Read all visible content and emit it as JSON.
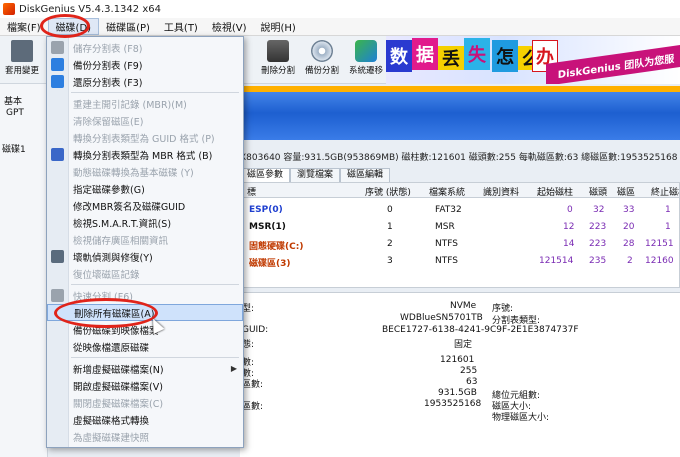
{
  "window": {
    "title": "DiskGenius V5.4.3.1342 x64"
  },
  "menubar": [
    "檔案(F)",
    "磁碟(D)",
    "磁碟區(P)",
    "工具(T)",
    "檢視(V)",
    "說明(H)"
  ],
  "toolbar": {
    "left_label": "套用變更",
    "buttons": [
      "刪除分割",
      "備份分割",
      "系統遷移"
    ]
  },
  "banner": {
    "tiles": [
      "数",
      "据",
      "丢",
      "失",
      "怎",
      "么",
      "办"
    ],
    "ribbon_text": "DiskGenius 团队为您服"
  },
  "left_panel": {
    "labels": [
      "基本",
      "GPT",
      "磁碟1 "
    ]
  },
  "disk_info": "X803640  容量:931.5GB(953869MB)  磁柱數:121601  磁頭數:255  每軌磁區數:63  總磁區數:1953525168",
  "tabs": [
    "磁區參數",
    "瀏覽檔案",
    "磁區編輯"
  ],
  "partition_table": {
    "headers": [
      "標",
      "序號 (狀態)",
      "檔案系統",
      "識別資料",
      "起始磁柱",
      "磁頭",
      "磁區",
      "終止磁柱"
    ],
    "rows": [
      {
        "name": "ESP(0)",
        "seq": "0",
        "fs": "FAT32",
        "cyl": "0",
        "head": "32",
        "sec": "33",
        "end": "1"
      },
      {
        "name": "MSR(1)",
        "seq": "1",
        "fs": "MSR",
        "cyl": "12",
        "head": "223",
        "sec": "20",
        "end": "1"
      },
      {
        "name": "固態硬碟(C:)",
        "seq": "2",
        "fs": "NTFS",
        "cyl": "14",
        "head": "223",
        "sec": "28",
        "end": "12151"
      },
      {
        "name": "磁碟區(3)",
        "seq": "3",
        "fs": "NTFS",
        "cyl": "121514",
        "head": "235",
        "sec": "2",
        "end": "12160"
      }
    ]
  },
  "details": {
    "type_label": "型:",
    "type_value": "NVMe",
    "model_value": "WDBlueSN5701TB",
    "guid_label": "GUID:",
    "guid_value": "BECE1727-6138-4241-9C9F-2E1E3874737F",
    "status_label": "態:",
    "status_value": "固定",
    "serial_label": "序號:",
    "ptype_label": "分割表類型:",
    "n1_label": "數:",
    "n1_value": "121601",
    "n2_label": "數:",
    "n2_value": "255",
    "n3_label": "區數:",
    "n3_value": "63",
    "cap_value": "931.5GB",
    "total_label": "區數:",
    "total_value": "1953525168",
    "r1": "總位元組數:",
    "r2": "磁區大小:",
    "r3": "物理磁區大小:"
  },
  "menu": {
    "items": [
      {
        "label": "儲存分割表 (F8)",
        "disabled": true,
        "icon": "save-icon"
      },
      {
        "label": "備份分割表 (F9)",
        "disabled": false,
        "icon": "backup-icon"
      },
      {
        "label": "還原分割表 (F3)",
        "disabled": false,
        "icon": "restore-icon"
      },
      {
        "sep": true
      },
      {
        "label": "重建主開引記錄 (MBR)(M)",
        "disabled": true,
        "icon": ""
      },
      {
        "label": "清除保留磁區(E)",
        "disabled": true,
        "icon": ""
      },
      {
        "label": "轉換分割表類型為 GUID 格式 (P)",
        "disabled": true,
        "icon": ""
      },
      {
        "label": "轉換分割表類型為 MBR 格式 (B)",
        "disabled": false,
        "icon": "convert-icon"
      },
      {
        "label": "動態磁碟轉換為基本磁碟 (Y)",
        "disabled": true,
        "icon": ""
      },
      {
        "label": "指定磁碟參數(G)",
        "disabled": false,
        "icon": ""
      },
      {
        "label": "修改MBR簽名及磁碟GUID",
        "disabled": false,
        "icon": ""
      },
      {
        "label": "檢視S.M.A.R.T.資訊(S)",
        "disabled": false,
        "icon": ""
      },
      {
        "label": "檢視儲存廣區相關資訊",
        "disabled": true,
        "icon": ""
      },
      {
        "label": "壞軌偵測與修復(Y)",
        "disabled": false,
        "icon": "tools-icon"
      },
      {
        "label": "復位壞磁區記錄",
        "disabled": true,
        "icon": ""
      },
      {
        "sep": true
      },
      {
        "label": "快速分割 (F6)",
        "disabled": true,
        "icon": "quick-icon"
      },
      {
        "label": "刪除所有磁碟區(A)",
        "disabled": false,
        "highlighted": true,
        "icon": ""
      },
      {
        "label": "備份磁碟到映像檔案",
        "disabled": false,
        "icon": ""
      },
      {
        "label": "從映像檔還原磁碟",
        "disabled": false,
        "icon": ""
      },
      {
        "sep": true
      },
      {
        "label": "新增虛擬磁碟檔案(N)",
        "disabled": false,
        "icon": "",
        "submenu": true
      },
      {
        "label": "開啟虛擬磁碟檔案(V)",
        "disabled": false,
        "icon": ""
      },
      {
        "label": "關閉虛擬磁碟檔案(C)",
        "disabled": true,
        "icon": ""
      },
      {
        "label": "虛擬磁碟格式轉換",
        "disabled": false,
        "icon": ""
      },
      {
        "label": "為虛擬磁碟建快照",
        "disabled": true,
        "icon": ""
      }
    ]
  },
  "colors": {
    "annotation_red": "#e0241a",
    "menu_highlight": "#cfe2fb",
    "disk_bar": "#1d5fd0"
  }
}
